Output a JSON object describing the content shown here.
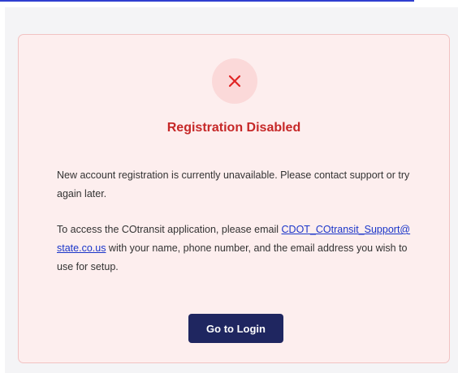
{
  "colors": {
    "accent_line": "#2f3fd0",
    "card_background": "#fdeeee",
    "card_border": "#f2c2c2",
    "icon_circle": "#fbd9d9",
    "error_red": "#e02424",
    "title_red": "#c62828",
    "link_blue": "#1a35c9",
    "button_navy": "#1f2660"
  },
  "card": {
    "icon": "close-x-icon",
    "title": "Registration Disabled",
    "message": "New account registration is currently unavailable. Please contact support or try again later.",
    "instructions_prefix": "To access the COtransit application, please email ",
    "support_email": "CDOT_COtransit_Support@state.co.us",
    "instructions_suffix": " with your name, phone number, and the email address you wish to use for setup.",
    "button_label": "Go to Login"
  }
}
